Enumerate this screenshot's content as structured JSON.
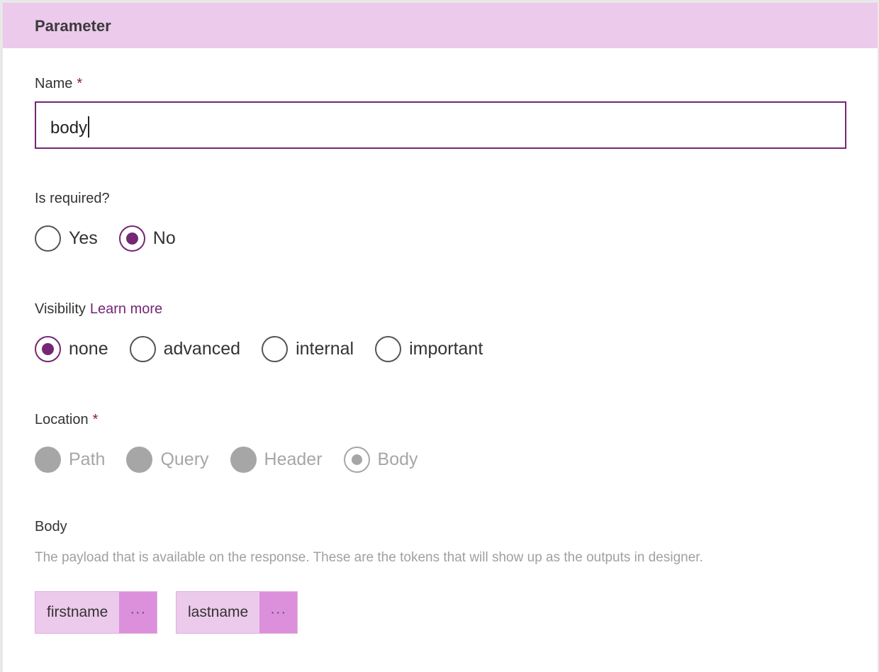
{
  "panel": {
    "title": "Parameter"
  },
  "name_field": {
    "label": "Name",
    "required_mark": "*",
    "value": "body"
  },
  "is_required": {
    "label": "Is required?",
    "options": [
      "Yes",
      "No"
    ],
    "selected": "No"
  },
  "visibility": {
    "label": "Visibility",
    "learn_more": "Learn more",
    "options": [
      "none",
      "advanced",
      "internal",
      "important"
    ],
    "selected": "none"
  },
  "location": {
    "label": "Location",
    "required_mark": "*",
    "options": [
      "Path",
      "Query",
      "Header",
      "Body"
    ],
    "selected": "Body",
    "disabled": true
  },
  "body_section": {
    "label": "Body",
    "helper": "The payload that is available on the response. These are the tokens that will show up as the outputs in designer.",
    "tokens": [
      {
        "label": "firstname",
        "more": "···"
      },
      {
        "label": "lastname",
        "more": "···"
      }
    ]
  },
  "colors": {
    "accent": "#742774",
    "header_bg": "#eccaec",
    "token_more_bg": "#dc90dc",
    "disabled": "#a6a6a6",
    "required_star": "#8a1e2e"
  }
}
